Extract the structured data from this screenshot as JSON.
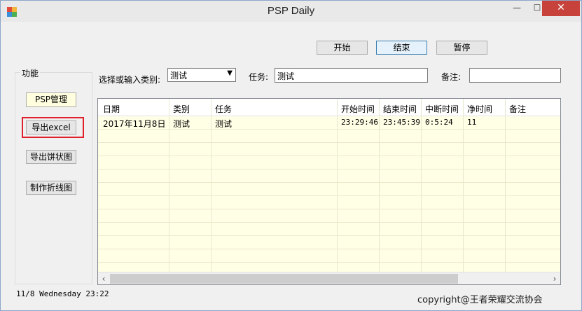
{
  "window": {
    "title": "PSP Daily",
    "min_glyph": "—",
    "max_glyph": "☐",
    "close_glyph": "✕"
  },
  "controls": {
    "start_label": "开始",
    "end_label": "结束",
    "pause_label": "暂停"
  },
  "group": {
    "title": "功能",
    "psp_manage_label": "PSP管理",
    "export_excel_label": "导出excel",
    "export_pie_label": "导出饼状图",
    "make_line_label": "制作折线图"
  },
  "form": {
    "category_label": "选择或输入类别:",
    "category_value": "测试",
    "task_label": "任务:",
    "task_value": "测试",
    "note_label": "备注:",
    "note_value": ""
  },
  "grid": {
    "columns": [
      "日期",
      "类别",
      "任务",
      "开始时间",
      "结束时间",
      "中断时间",
      "净时间",
      "备注"
    ],
    "rows": [
      [
        "2017年11月8日",
        "测试",
        "测试",
        "23:29:46",
        "23:45:39",
        "0:5:24",
        "11",
        ""
      ]
    ],
    "scroll_left": "‹",
    "scroll_right": "›"
  },
  "status": {
    "text": "11/8  Wednesday 23:22"
  },
  "footer": {
    "copyright": "copyright@王者荣耀交流协会"
  },
  "colors": {
    "close_button": "#c7423a",
    "grid_background": "#ffffe6",
    "highlight_border": "#e0202a"
  }
}
